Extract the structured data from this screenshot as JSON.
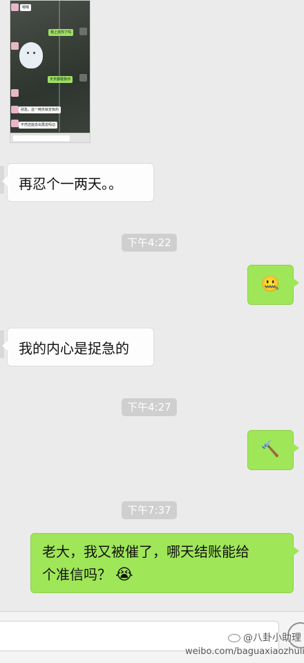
{
  "embedded_screenshot": {
    "messages": [
      {
        "side": "left",
        "text": "嗯嗯"
      },
      {
        "side": "right",
        "text": "我上完你了吗"
      },
      {
        "side": "right",
        "text": "天天都催我😓"
      },
      {
        "side": "left",
        "text": "别急，这一两天就定有的"
      },
      {
        "side": "left",
        "text": "不然还能去出再去吗😊"
      }
    ]
  },
  "chat": {
    "msg1": "再忍个一两天。。",
    "time1": "下午4:22",
    "emoji1": "🤐",
    "msg2": "我的内心是捉急的",
    "time2": "下午4:27",
    "emoji2": "🔨",
    "time3": "下午7:37",
    "msg3_line1": "老大，我又被催了，哪天结账能给",
    "msg3_line2": "个准信吗？",
    "msg3_emoji": "😭"
  },
  "watermark": {
    "handle": "@八卦小助理",
    "url": "weibo.com/baguaxiaozhuli"
  },
  "colors": {
    "background": "#ebebeb",
    "green_bubble": "#9fe658",
    "white_bubble": "#fdfdfd",
    "time_badge": "#cfcfcf"
  }
}
